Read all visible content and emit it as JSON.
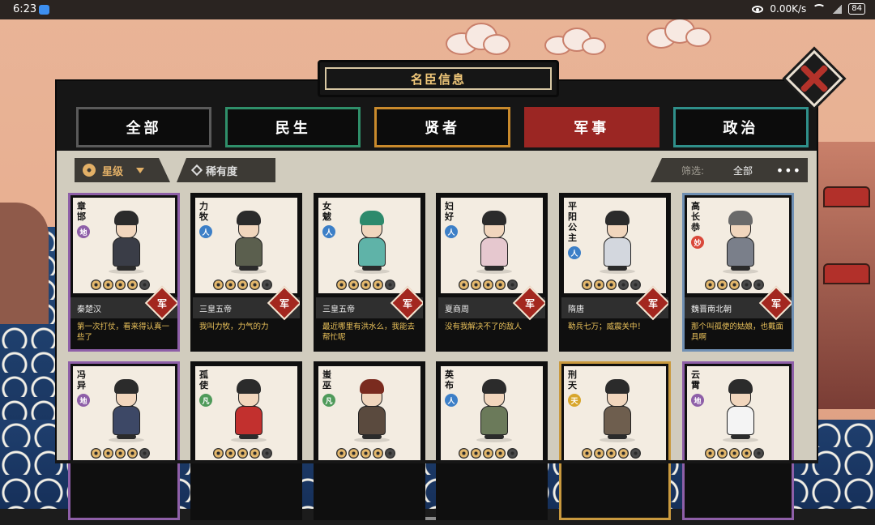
{
  "status_bar": {
    "time": "6:23",
    "net_speed": "0.00K/s",
    "battery": "84"
  },
  "panel": {
    "title": "名臣信息"
  },
  "tabs": [
    {
      "label": "全部",
      "accent": "#5a5a5a"
    },
    {
      "label": "民生",
      "accent": "#2f8f6a"
    },
    {
      "label": "贤者",
      "accent": "#c98a2c"
    },
    {
      "label": "军事",
      "accent": "#9b2623",
      "selected": true
    },
    {
      "label": "政治",
      "accent": "#2f8f8a"
    }
  ],
  "sort": {
    "star_label": "星级",
    "rarity_label": "稀有度"
  },
  "filter": {
    "label": "筛选:",
    "value": "全部",
    "more": "•••"
  },
  "badge_text": "军",
  "cards": [
    {
      "name": "章邯",
      "rank": "地",
      "rank_color": "#8e5fa8",
      "stars": 4,
      "era": "秦楚汉",
      "quote": "第一次打仗，看来得认真一些了"
    },
    {
      "name": "力牧",
      "rank": "人",
      "rank_color": "#3c7fc7",
      "stars": 4,
      "era": "三皇五帝",
      "quote": "我叫力牧，力气的力"
    },
    {
      "name": "女魃",
      "rank": "人",
      "rank_color": "#3c7fc7",
      "stars": 4,
      "era": "三皇五帝",
      "quote": "最近哪里有洪水么，我能去帮忙呢"
    },
    {
      "name": "妇好",
      "rank": "人",
      "rank_color": "#3c7fc7",
      "stars": 4,
      "era": "夏商周",
      "quote": "没有我解决不了的敌人"
    },
    {
      "name": "平阳公主",
      "rank": "人",
      "rank_color": "#3c7fc7",
      "stars": 3,
      "era": "隋唐",
      "quote": "勒兵七万；威震关中！"
    },
    {
      "name": "高长恭",
      "rank": "妙",
      "rank_color": "#d9483a",
      "stars": 3,
      "era": "魏晋南北朝",
      "quote": "那个叫孤使的姑娘，也戴面具啊"
    },
    {
      "name": "冯异",
      "rank": "地",
      "rank_color": "#8e5fa8",
      "stars": 4
    },
    {
      "name": "孤使",
      "rank": "凡",
      "rank_color": "#4f9a5a",
      "stars": 4
    },
    {
      "name": "蚩巫",
      "rank": "凡",
      "rank_color": "#4f9a5a",
      "stars": 4
    },
    {
      "name": "英布",
      "rank": "人",
      "rank_color": "#3c7fc7",
      "stars": 4
    },
    {
      "name": "刑天",
      "rank": "天",
      "rank_color": "#d8a62b",
      "stars": 4
    },
    {
      "name": "云霄",
      "rank": "地",
      "rank_color": "#8e5fa8",
      "stars": 4
    }
  ]
}
